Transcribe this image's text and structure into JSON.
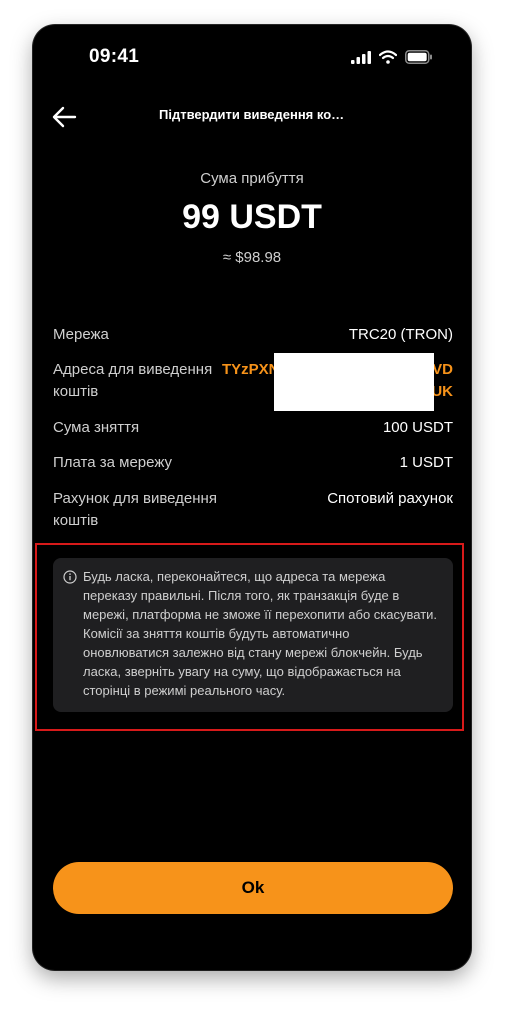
{
  "status_bar": {
    "time": "09:41"
  },
  "header": {
    "title": "Підтвердити виведення ко…"
  },
  "summary": {
    "label": "Сума прибуття",
    "amount": "99 USDT",
    "approx": "≈ $98.98"
  },
  "details": {
    "network": {
      "label": "Мережа",
      "value": "TRC20 (TRON)"
    },
    "address": {
      "label": "Адреса для виведення коштів",
      "value_line1_start": "TYzPXN",
      "value_line1_end": "VD",
      "value_line2_end": "UK"
    },
    "withdraw_amount": {
      "label": "Сума зняття",
      "value": "100 USDT"
    },
    "network_fee": {
      "label": "Плата за мережу",
      "value": "1 USDT"
    },
    "account": {
      "label": "Рахунок для виведення коштів",
      "value": "Спотовий рахунок"
    }
  },
  "notice": {
    "text": "Будь ласка, переконайтеся, що адреса та мережа переказу правильні. Після того, як транзакція буде в мережі, платформа не зможе її перехопити або скасувати. Комісії за зняття коштів будуть автоматично оновлюватися залежно від стану мережі блокчейн. Будь ласка, зверніть увагу на суму, що відображається на сторінці в режимі реального часу."
  },
  "buttons": {
    "ok": "Ok"
  },
  "colors": {
    "accent": "#f7931a",
    "background": "#000000",
    "notice_bg": "#1f1f21",
    "highlight_outline": "#d71a1a"
  },
  "icons": [
    "signal-icon",
    "wifi-icon",
    "battery-icon",
    "back-arrow-icon",
    "info-icon"
  ]
}
